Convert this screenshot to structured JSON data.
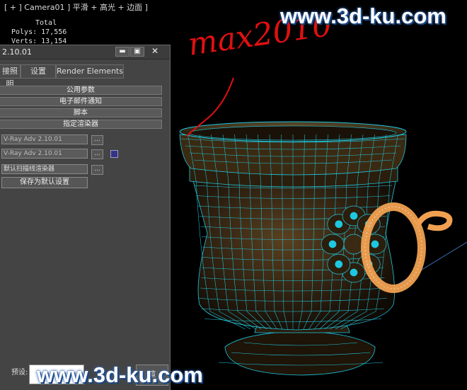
{
  "viewport": {
    "label": "[ + ] Camera01 ] 平滑 + 高光 + 边面 ]",
    "stats": {
      "total_label": "Total",
      "polys_label": "Polys:",
      "polys": "17,556",
      "verts_label": "Verts:",
      "verts": "13,154"
    },
    "handwriting": "max2010",
    "watermark_top": "www.3d-ku.com",
    "watermark_bottom": "www.3d-ku.com",
    "colors": {
      "mesh": "#1ec8e0",
      "handle": "#f0a050",
      "annotation": "#e01010",
      "cup_body": "#3a2a14"
    }
  },
  "dialog": {
    "title": "2.10.01",
    "window_buttons": {
      "minimize": "▬",
      "restore": "▣",
      "close": "✕"
    },
    "tabs": [
      "接照明",
      "设置",
      "Render Elements"
    ],
    "rollouts": [
      "公用参数",
      "电子邮件通知",
      "脚本",
      "指定渲染器"
    ],
    "renderers": {
      "production": "V-Ray Adv 2.10.01",
      "material_editor": "V-Ray Adv 2.10.01",
      "activeshade": "默认扫描线渲染器",
      "browse": "..."
    },
    "save_default": "保存为默认设置",
    "preset_label": "预设:",
    "render_label": "渲"
  }
}
